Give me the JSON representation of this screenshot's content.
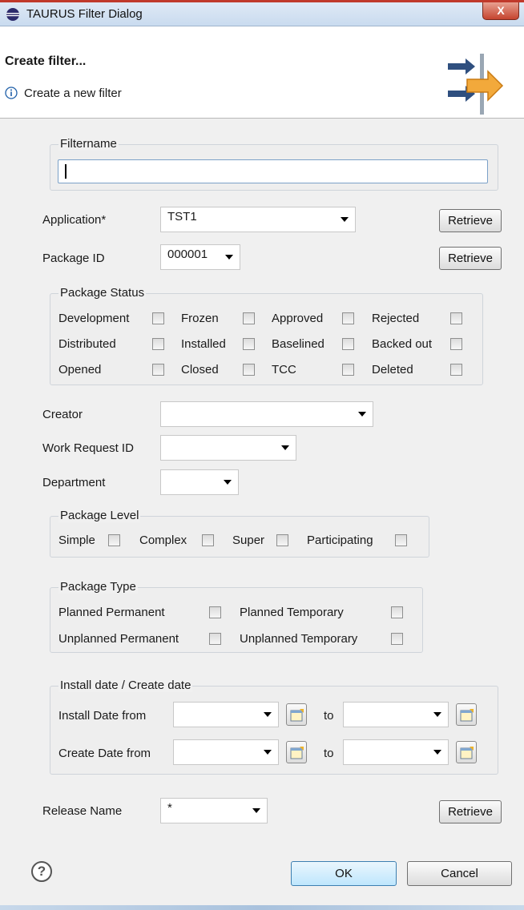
{
  "window": {
    "title": "TAURUS Filter Dialog",
    "close_label": "X"
  },
  "header": {
    "title": "Create filter...",
    "message": "Create a new filter"
  },
  "filtername": {
    "group_label": "Filtername",
    "value": ""
  },
  "application": {
    "label": "Application*",
    "value": "TST1",
    "retrieve_label": "Retrieve"
  },
  "package_id": {
    "label": "Package ID",
    "value": "000001",
    "retrieve_label": "Retrieve"
  },
  "package_status": {
    "group_label": "Package Status",
    "items": [
      {
        "label": "Development",
        "checked": false
      },
      {
        "label": "Frozen",
        "checked": false
      },
      {
        "label": "Approved",
        "checked": false
      },
      {
        "label": "Rejected",
        "checked": false
      },
      {
        "label": "Distributed",
        "checked": false
      },
      {
        "label": "Installed",
        "checked": false
      },
      {
        "label": "Baselined",
        "checked": false
      },
      {
        "label": "Backed out",
        "checked": false
      },
      {
        "label": "Opened",
        "checked": false
      },
      {
        "label": "Closed",
        "checked": false
      },
      {
        "label": "TCC",
        "checked": false
      },
      {
        "label": "Deleted",
        "checked": false
      }
    ]
  },
  "creator": {
    "label": "Creator",
    "value": ""
  },
  "work_request": {
    "label": "Work Request ID",
    "value": ""
  },
  "department": {
    "label": "Department",
    "value": ""
  },
  "package_level": {
    "group_label": "Package Level",
    "items": [
      {
        "label": "Simple",
        "checked": false
      },
      {
        "label": "Complex",
        "checked": false
      },
      {
        "label": "Super",
        "checked": false
      },
      {
        "label": "Participating",
        "checked": false
      }
    ]
  },
  "package_type": {
    "group_label": "Package Type",
    "items": [
      {
        "label": "Planned Permanent",
        "checked": false
      },
      {
        "label": "Planned Temporary",
        "checked": false
      },
      {
        "label": "Unplanned Permanent",
        "checked": false
      },
      {
        "label": "Unplanned Temporary",
        "checked": false
      }
    ]
  },
  "dates": {
    "group_label": "Install date / Create date",
    "install_label": "Install Date from",
    "create_label": "Create Date from",
    "to_label": "to",
    "install_from": "",
    "install_to": "",
    "create_from": "",
    "create_to": ""
  },
  "release": {
    "label": "Release Name",
    "value": "*",
    "retrieve_label": "Retrieve"
  },
  "footer": {
    "ok_label": "OK",
    "cancel_label": "Cancel",
    "help_glyph": "?"
  }
}
